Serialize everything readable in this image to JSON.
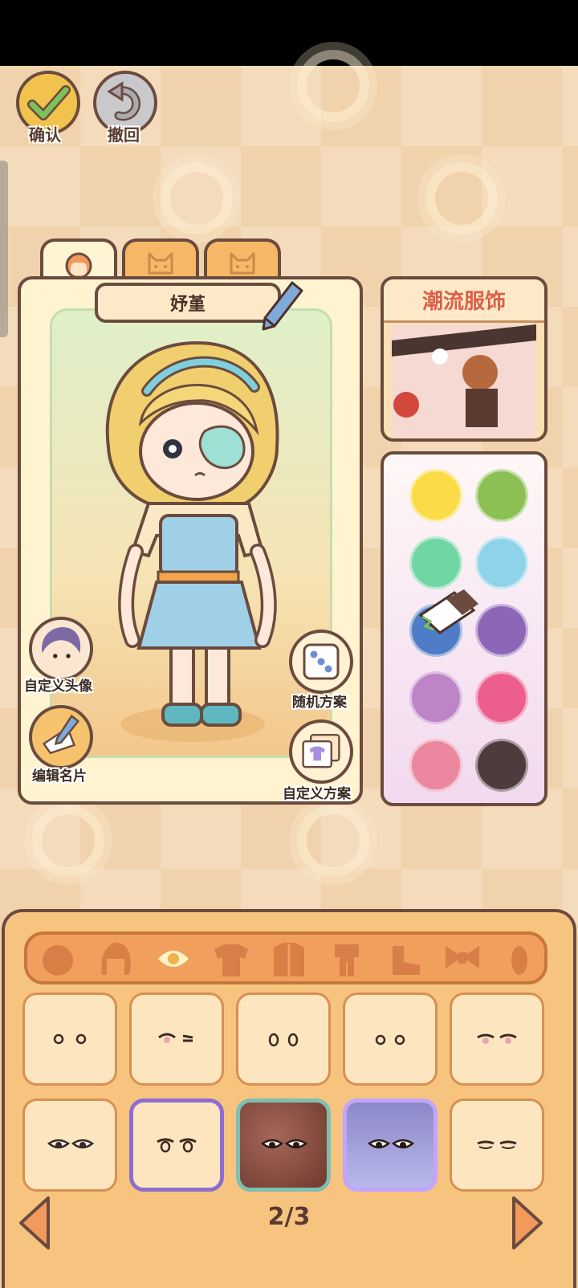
{
  "toolbar": {
    "confirm_label": "确认",
    "undo_label": "撤回"
  },
  "character": {
    "name": "妤堇"
  },
  "side_actions": {
    "custom_avatar_label": "自定义头像",
    "edit_card_label": "编辑名片",
    "random_plan_label": "随机方案",
    "custom_plan_label": "自定义方案"
  },
  "fashion": {
    "title": "潮流服饰"
  },
  "palette": {
    "colors": [
      "#fbdc48",
      "#8cc055",
      "#6fd6a4",
      "#8fd3ea",
      "#4e7cc7",
      "#8e66b8",
      "#bd84c8",
      "#ec5e8e",
      "#ea879f",
      "#4d3b3d"
    ]
  },
  "category_icons": [
    "face-icon",
    "hair-icon",
    "eyes-icon",
    "top-icon",
    "coat-icon",
    "outfit-icon",
    "shoes-icon",
    "bow-icon",
    "more-icon"
  ],
  "pagination": {
    "current": "2/3"
  }
}
